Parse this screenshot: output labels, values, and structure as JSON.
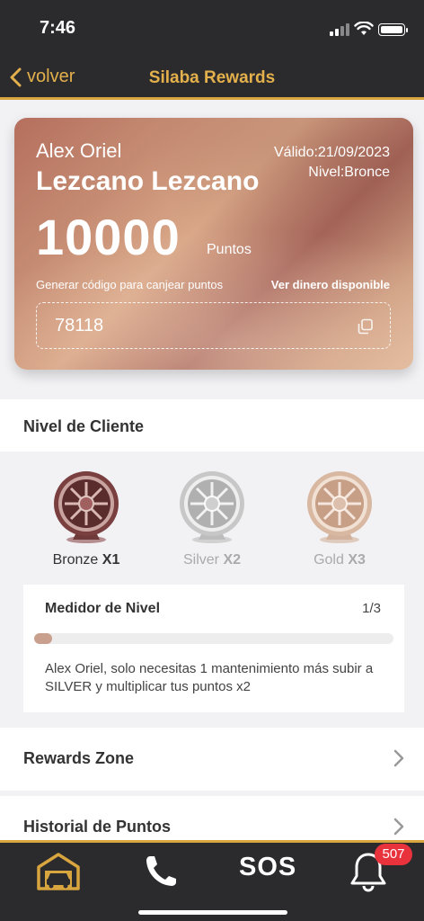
{
  "status_bar": {
    "time": "7:46"
  },
  "nav": {
    "back_label": "volver",
    "title": "Silaba Rewards"
  },
  "card": {
    "first_name": "Alex Oriel",
    "last_name": "Lezcano Lezcano",
    "valid_label": "Válido:21/09/2023",
    "level_label": "Nivel:Bronce",
    "points": "10000",
    "points_unit": "Puntos",
    "generate_code_label": "Generar código para canjear puntos",
    "view_money_label": "Ver dinero disponible",
    "code": "78118"
  },
  "client_level": {
    "title": "Nivel de Cliente",
    "levels": [
      {
        "name": "Bronze",
        "multiplier": "X1",
        "active": true,
        "color": "#8a4b4b"
      },
      {
        "name": "Silver",
        "multiplier": "X2",
        "active": false,
        "color": "#c9c9c9"
      },
      {
        "name": "Gold",
        "multiplier": "X3",
        "active": false,
        "color": "#d8b8a0"
      }
    ],
    "meter": {
      "title": "Medidor de Nivel",
      "count": "1/3",
      "progress_fraction": 0.05,
      "message": "Alex Oriel, solo necesitas 1 mantenimiento más subir a SILVER y multiplicar tus puntos x2"
    }
  },
  "menu": [
    {
      "label": "Rewards Zone"
    },
    {
      "label": "Historial de Puntos"
    }
  ],
  "tabbar": {
    "sos_label": "SOS",
    "notifications_count": "507",
    "accent": "#d9a53f",
    "badge_color": "#e8333d"
  }
}
